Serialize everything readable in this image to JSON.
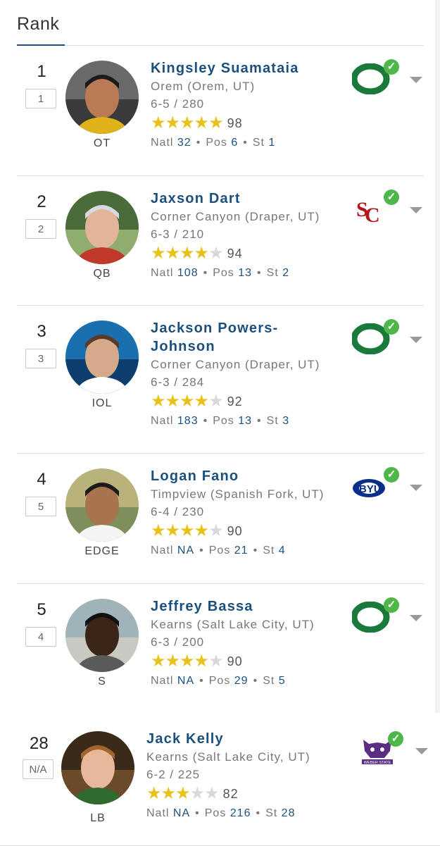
{
  "header": {
    "title": "Rank"
  },
  "players": [
    {
      "rank": "1",
      "prev_rank": "1",
      "position": "OT",
      "name": "Kingsley Suamataia",
      "school": "Orem (Orem, UT)",
      "height_weight": "6-5 / 280",
      "stars": 5,
      "rating": "98",
      "natl": "32",
      "pos_rank": "6",
      "st_rank": "1",
      "logo": "oregon-logo",
      "team_color": "#1a7a3b"
    },
    {
      "rank": "2",
      "prev_rank": "2",
      "position": "QB",
      "name": "Jaxson Dart",
      "school": "Corner Canyon (Draper, UT)",
      "height_weight": "6-3 / 210",
      "stars": 4,
      "rating": "94",
      "natl": "108",
      "pos_rank": "13",
      "st_rank": "2",
      "logo": "usc-logo",
      "team_color": "#b1161c"
    },
    {
      "rank": "3",
      "prev_rank": "3",
      "position": "IOL",
      "name": "Jackson Powers-Johnson",
      "school": "Corner Canyon (Draper, UT)",
      "height_weight": "6-3 / 284",
      "stars": 4,
      "rating": "92",
      "natl": "183",
      "pos_rank": "13",
      "st_rank": "3",
      "logo": "oregon-logo",
      "team_color": "#1a7a3b"
    },
    {
      "rank": "4",
      "prev_rank": "5",
      "position": "EDGE",
      "name": "Logan Fano",
      "school": "Timpview (Spanish Fork, UT)",
      "height_weight": "6-4 / 230",
      "stars": 4,
      "rating": "90",
      "natl": "NA",
      "pos_rank": "21",
      "st_rank": "4",
      "logo": "byu-logo",
      "team_color": "#0a2f8a"
    },
    {
      "rank": "5",
      "prev_rank": "4",
      "position": "S",
      "name": "Jeffrey Bassa",
      "school": "Kearns (Salt Lake City, UT)",
      "height_weight": "6-3 / 200",
      "stars": 4,
      "rating": "90",
      "natl": "NA",
      "pos_rank": "29",
      "st_rank": "5",
      "logo": "oregon-logo",
      "team_color": "#1a7a3b"
    },
    {
      "rank": "28",
      "prev_rank": "N/A",
      "position": "LB",
      "name": "Jack Kelly",
      "school": "Kearns (Salt Lake City, UT)",
      "height_weight": "6-2 / 225",
      "stars": 3,
      "rating": "82",
      "natl": "NA",
      "pos_rank": "216",
      "st_rank": "28",
      "logo": "weber-state-logo",
      "team_color": "#5b2c83"
    }
  ],
  "labels": {
    "natl": "Natl",
    "pos": "Pos",
    "st": "St",
    "weber_text": "WEBER STATE"
  },
  "colors": {
    "link": "#1b4f7d",
    "star_on": "#e8c21a",
    "star_off": "#d8d8d8",
    "commit_check": "#4fb64a"
  }
}
